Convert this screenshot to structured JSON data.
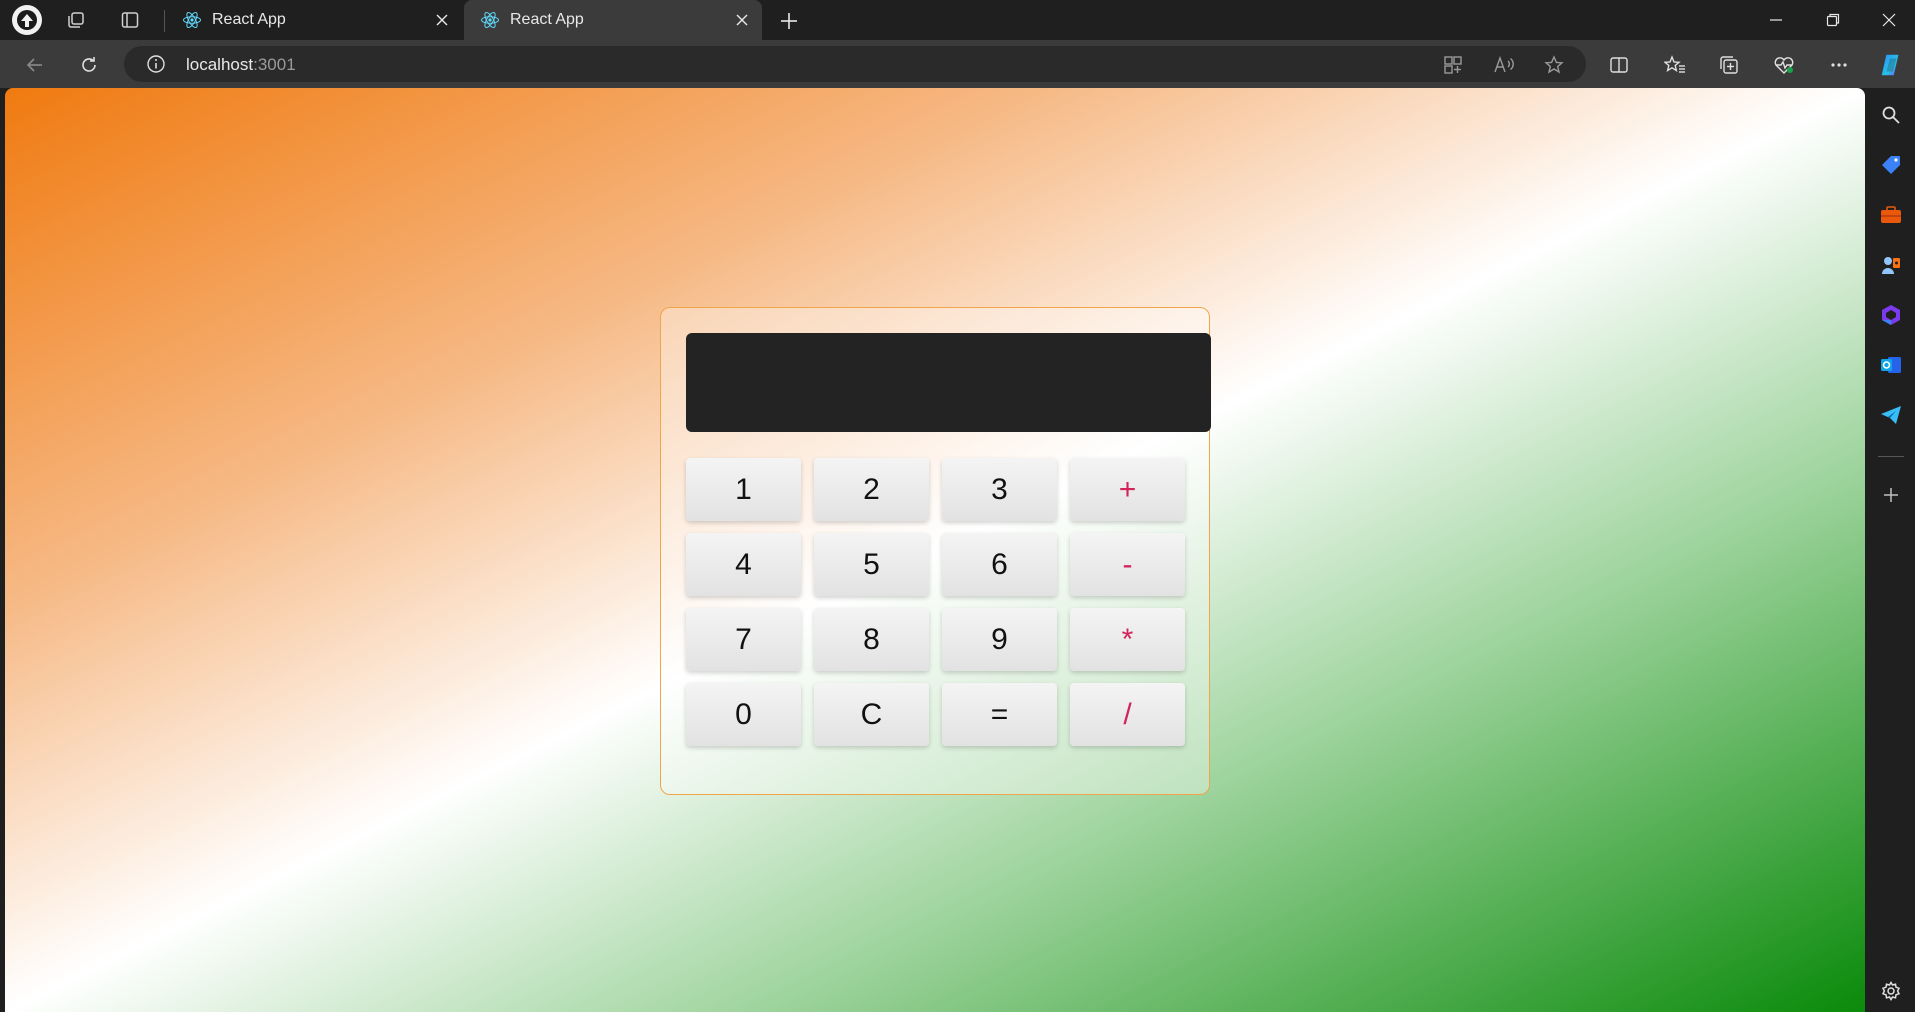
{
  "tabs": [
    {
      "title": "React App"
    },
    {
      "title": "React App"
    }
  ],
  "address_bar": {
    "host": "localhost",
    "port": ":3001"
  },
  "calculator": {
    "display": "",
    "rows": [
      [
        {
          "label": "1",
          "op": false
        },
        {
          "label": "2",
          "op": false
        },
        {
          "label": "3",
          "op": false
        },
        {
          "label": "+",
          "op": true
        }
      ],
      [
        {
          "label": "4",
          "op": false
        },
        {
          "label": "5",
          "op": false
        },
        {
          "label": "6",
          "op": false
        },
        {
          "label": "-",
          "op": true
        }
      ],
      [
        {
          "label": "7",
          "op": false
        },
        {
          "label": "8",
          "op": false
        },
        {
          "label": "9",
          "op": false
        },
        {
          "label": "*",
          "op": true
        }
      ],
      [
        {
          "label": "0",
          "op": false
        },
        {
          "label": "C",
          "op": false
        },
        {
          "label": "=",
          "op": false
        },
        {
          "label": "/",
          "op": true
        }
      ]
    ]
  },
  "colors": {
    "gradient_start": "#f07a10",
    "gradient_mid": "#ffffff",
    "gradient_end": "#0a8a0a",
    "display_bg": "#232323",
    "operator_text": "#d2245a",
    "calc_border": "#f0a54a"
  },
  "icons": {
    "tab_strip": [
      "profile-icon",
      "workspaces-icon",
      "vertical-tabs-icon"
    ],
    "toolbar": [
      "back-icon",
      "refresh-icon",
      "info-icon",
      "app-available-icon",
      "read-aloud-icon",
      "favorite-star-icon",
      "split-screen-icon",
      "favorites-icon",
      "collections-icon",
      "browser-essentials-icon",
      "more-options-icon",
      "copilot-icon"
    ],
    "sidebar": [
      "search-icon",
      "shopping-tag-icon",
      "tools-briefcase-icon",
      "games-icon",
      "microsoft365-icon",
      "outlook-icon",
      "telegram-icon",
      "add-icon",
      "settings-icon"
    ]
  }
}
